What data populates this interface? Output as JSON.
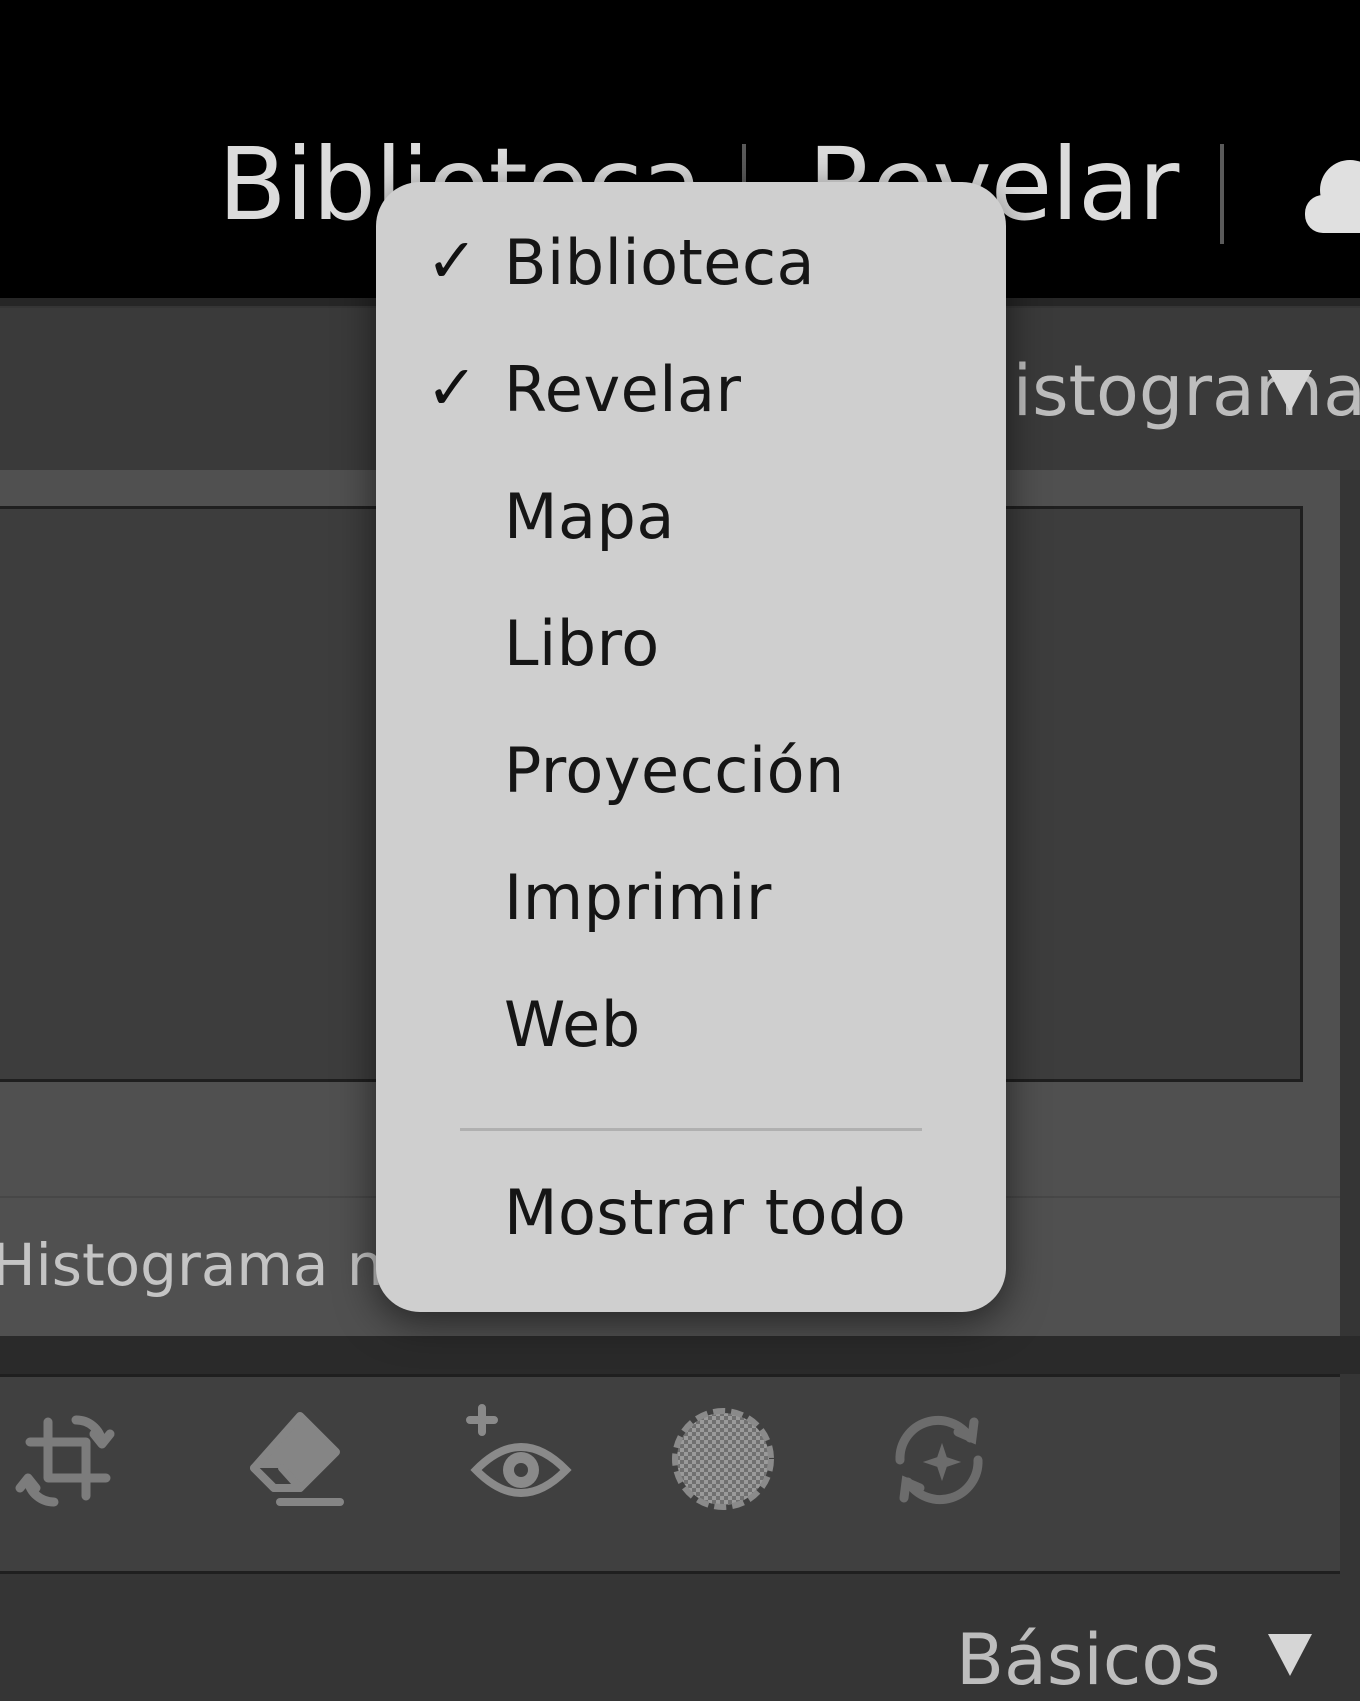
{
  "module_bar": {
    "items": [
      "Biblioteca",
      "Revelar"
    ],
    "cloud_icon": "cloud-icon"
  },
  "panel": {
    "histogram_title": "Histograma",
    "histogram_status": "Histograma no disponible",
    "basic_title": "Básicos"
  },
  "tools": [
    {
      "name": "crop-icon"
    },
    {
      "name": "eraser-icon"
    },
    {
      "name": "red-eye-icon"
    },
    {
      "name": "masking-icon"
    },
    {
      "name": "reset-icon"
    }
  ],
  "menu": {
    "items": [
      {
        "label": "Biblioteca",
        "checked": "✓"
      },
      {
        "label": "Revelar",
        "checked": "✓"
      },
      {
        "label": "Mapa",
        "checked": ""
      },
      {
        "label": "Libro",
        "checked": ""
      },
      {
        "label": "Proyección",
        "checked": ""
      },
      {
        "label": "Imprimir",
        "checked": ""
      },
      {
        "label": "Web",
        "checked": ""
      }
    ],
    "show_all": "Mostrar todo"
  }
}
